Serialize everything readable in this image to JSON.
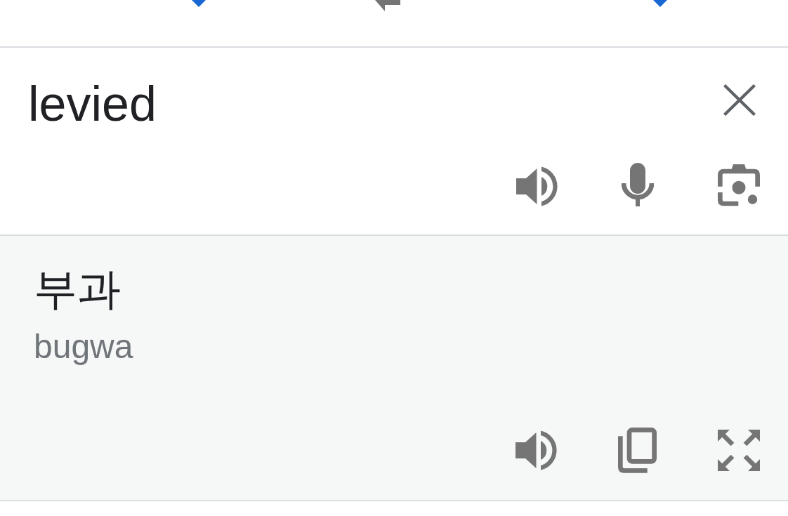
{
  "source_field": {
    "value": "levied"
  },
  "result": {
    "translation": "부과",
    "romanization": "bugwa"
  }
}
